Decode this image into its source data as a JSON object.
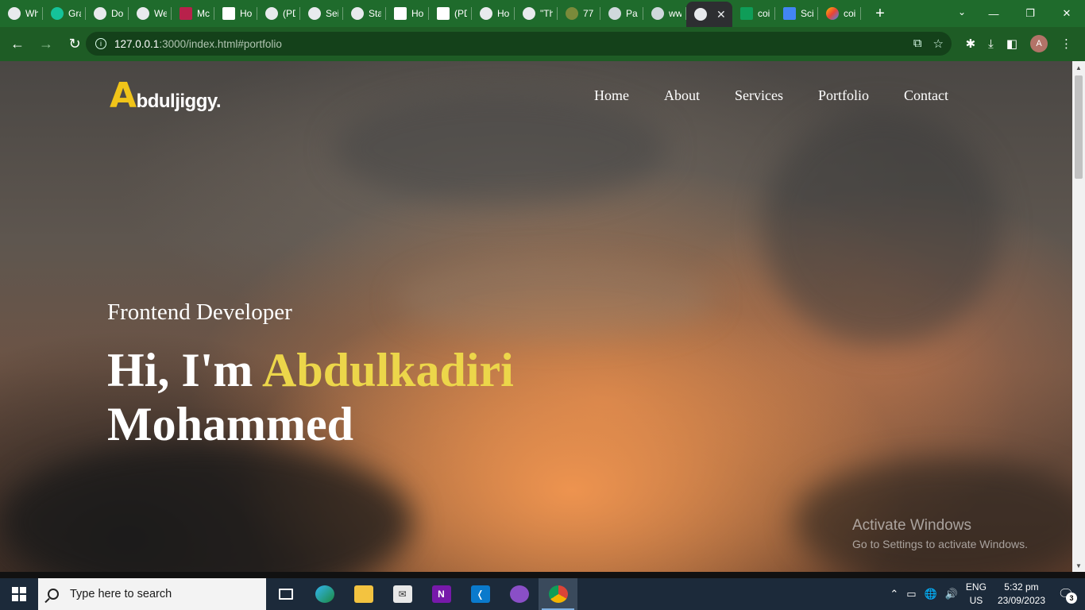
{
  "browser": {
    "tabs": [
      {
        "label": "Wh",
        "icon": "chrome-icon",
        "kind": "globe"
      },
      {
        "label": "Gra",
        "icon": "grammarly-icon",
        "kind": "g"
      },
      {
        "label": "Do",
        "icon": "globe-icon",
        "kind": "globe"
      },
      {
        "label": "We",
        "icon": "globe-icon",
        "kind": "globe"
      },
      {
        "label": "Mc",
        "icon": "delta-icon",
        "kind": "red"
      },
      {
        "label": "Ho",
        "icon": "sheet-icon",
        "kind": "sheet"
      },
      {
        "label": "(PD",
        "icon": "globe-icon",
        "kind": "globe"
      },
      {
        "label": "Sei",
        "icon": "globe-icon",
        "kind": "globe"
      },
      {
        "label": "Sta",
        "icon": "globe-icon",
        "kind": "globe"
      },
      {
        "label": "Ho",
        "icon": "sheet-icon",
        "kind": "sheet"
      },
      {
        "label": "(PD",
        "icon": "researchgate-icon",
        "kind": "r"
      },
      {
        "label": "Ho",
        "icon": "globe-icon",
        "kind": "globe"
      },
      {
        "label": "\"Th",
        "icon": "globe-icon",
        "kind": "globe"
      },
      {
        "label": "77",
        "icon": "seal-icon",
        "kind": "seal"
      },
      {
        "label": "Pa",
        "icon": "pa-icon",
        "kind": "pa"
      },
      {
        "label": "ww",
        "icon": "pa-icon",
        "kind": "pa"
      }
    ],
    "active_tab": {
      "icon": "globe-icon",
      "close": "✕"
    },
    "tabs_after": [
      {
        "label": "coi",
        "icon": "sheets-plus-icon",
        "kind": "green"
      },
      {
        "label": "Sci",
        "icon": "docs-icon",
        "kind": "doc"
      },
      {
        "label": "coi",
        "icon": "colorful-icon",
        "kind": "multi"
      }
    ],
    "new_tab": "+",
    "window_controls": {
      "tab_search": "⌄",
      "minimize": "—",
      "restore": "❐",
      "close": "✕"
    },
    "url_host": "127.0.0.1",
    "url_path": ":3000/index.html#portfolio",
    "avatar_letter": "A"
  },
  "site": {
    "logo_initial": "A",
    "logo_rest": "bduljiggy.",
    "nav": [
      "Home",
      "About",
      "Services",
      "Portfolio",
      "Contact"
    ],
    "role": "Frontend Developer",
    "greeting": "Hi, I'm ",
    "name_first": "Abdulkadiri",
    "name_last": "Mohammed"
  },
  "watermark": {
    "title": "Activate Windows",
    "subtitle": "Go to Settings to activate Windows."
  },
  "taskbar": {
    "search_placeholder": "Type here to search",
    "lang_top": "ENG",
    "lang_bottom": "US",
    "time": "5:32 pm",
    "date": "23/09/2023",
    "notification_count": "3"
  },
  "colors": {
    "tab_strip": "#1f6b2c",
    "toolbar": "#1e5c25",
    "accent_name": "#ecd64a",
    "logo_accent": "#f0c419"
  }
}
